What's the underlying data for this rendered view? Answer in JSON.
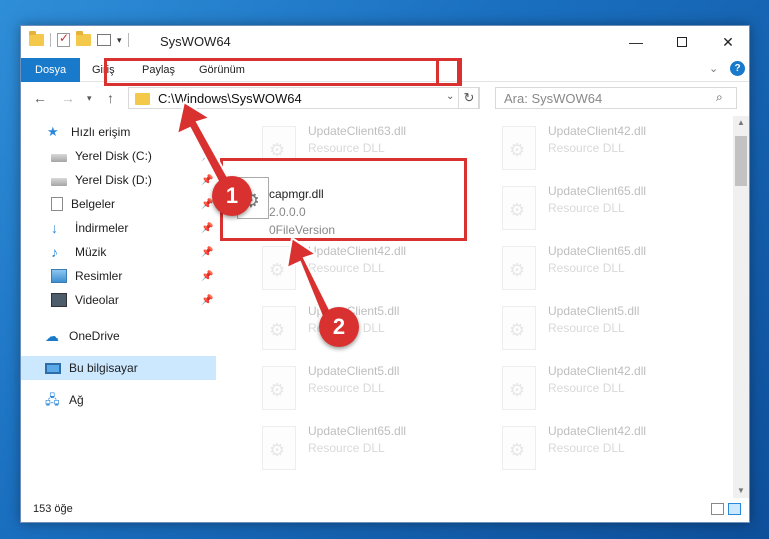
{
  "window": {
    "title": "SysWOW64"
  },
  "ribbon": {
    "tabs": [
      "Dosya",
      "Giriş",
      "Paylaş",
      "Görünüm"
    ]
  },
  "address": {
    "path": "C:\\Windows\\SysWOW64",
    "search_placeholder": "Ara: SysWOW64"
  },
  "sidebar": {
    "items": [
      {
        "label": "Hızlı erişim",
        "icon": "star-icon",
        "pinned": false
      },
      {
        "label": "Yerel Disk (C:)",
        "icon": "disk-icon",
        "pinned": true
      },
      {
        "label": "Yerel Disk (D:)",
        "icon": "disk-icon",
        "pinned": true
      },
      {
        "label": "Belgeler",
        "icon": "documents-icon",
        "pinned": true
      },
      {
        "label": "İndirmeler",
        "icon": "downloads-icon",
        "pinned": true
      },
      {
        "label": "Müzik",
        "icon": "music-icon",
        "pinned": true
      },
      {
        "label": "Resimler",
        "icon": "pictures-icon",
        "pinned": true
      },
      {
        "label": "Videolar",
        "icon": "videos-icon",
        "pinned": true
      },
      {
        "label": "OneDrive",
        "icon": "onedrive-icon",
        "pinned": false
      },
      {
        "label": "Bu bilgisayar",
        "icon": "computer-icon",
        "pinned": false,
        "selected": true
      },
      {
        "label": "Ağ",
        "icon": "network-icon",
        "pinned": false
      }
    ]
  },
  "files": {
    "left": [
      {
        "name": "UpdateClient63.dll",
        "type": "Resource DLL"
      },
      {
        "name": "UpdateClient42.dll",
        "type": "Resource DLL"
      },
      {
        "name": "UpdateClient5.dll",
        "type": "Resource DLL"
      },
      {
        "name": "UpdateClient5.dll",
        "type": "Resource DLL"
      },
      {
        "name": "UpdateClient65.dll",
        "type": "Resource DLL"
      }
    ],
    "right": [
      {
        "name": "UpdateClient42.dll",
        "type": "Resource DLL"
      },
      {
        "name": "UpdateClient65.dll",
        "type": "Resource DLL"
      },
      {
        "name": "UpdateClient65.dll",
        "type": "Resource DLL"
      },
      {
        "name": "UpdateClient5.dll",
        "type": "Resource DLL"
      },
      {
        "name": "UpdateClient42.dll",
        "type": "Resource DLL"
      },
      {
        "name": "UpdateClient42.dll",
        "type": "Resource DLL"
      }
    ],
    "highlighted": {
      "name": "capmgr.dll",
      "version": "2.0.0.0",
      "description": "0FileVersion"
    }
  },
  "status": {
    "count": "153 öğe"
  },
  "annotations": {
    "badge1": "1",
    "badge2": "2",
    "accent": "#d9312f"
  }
}
